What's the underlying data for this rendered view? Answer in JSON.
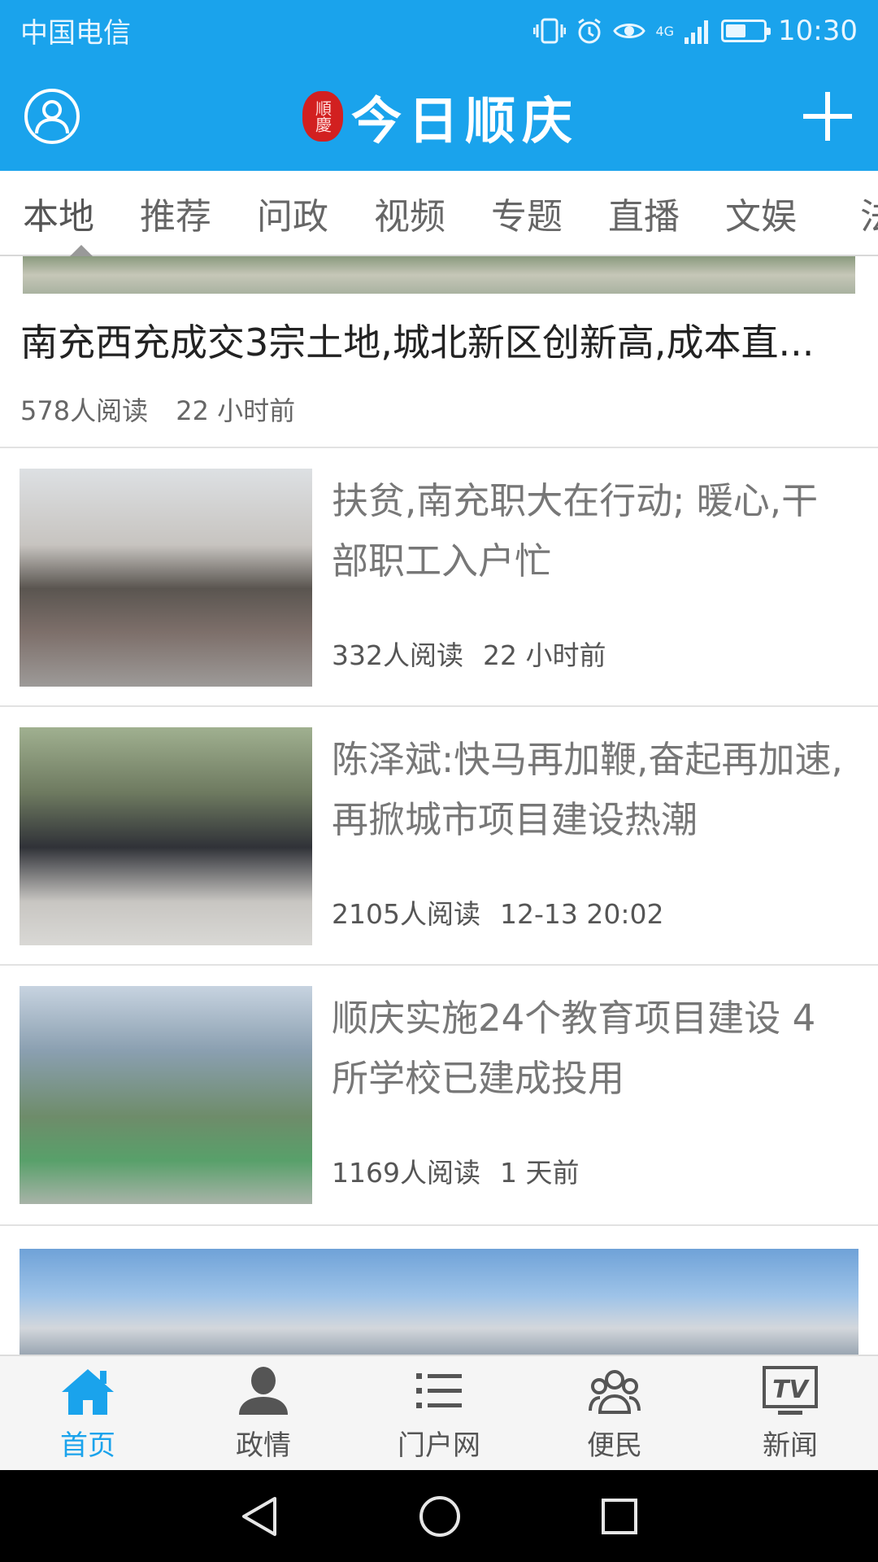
{
  "status_bar": {
    "carrier": "中国电信",
    "network": "4G",
    "time": "10:30",
    "battery_level": 0.55
  },
  "header": {
    "logo_seal": "順慶",
    "logo_text": "今日顺庆",
    "icons": [
      "avatar-icon",
      "plus-icon"
    ]
  },
  "tabs": [
    {
      "label": "本地",
      "active": true
    },
    {
      "label": "推荐"
    },
    {
      "label": "问政"
    },
    {
      "label": "视频"
    },
    {
      "label": "专题"
    },
    {
      "label": "直播"
    },
    {
      "label": "文娱"
    },
    {
      "label": "法"
    }
  ],
  "feed": {
    "featured": {
      "title": "南充西充成交3宗土地,城北新区创新高,成本直...",
      "reads": "578人阅读",
      "time": "22 小时前"
    },
    "items": [
      {
        "title": "扶贫,南充职大在行动; 暖心,干部职工入户忙",
        "reads": "332人阅读",
        "time": "22 小时前"
      },
      {
        "title": "陈泽斌:快马再加鞭,奋起再加速,再掀城市项目建设热潮",
        "reads": "2105人阅读",
        "time": "12-13 20:02"
      },
      {
        "title": "顺庆实施24个教育项目建设 4所学校已建成投用",
        "reads": "1169人阅读",
        "time": "1 天前"
      }
    ]
  },
  "bottom_nav": [
    {
      "label": "首页",
      "icon": "home-icon",
      "active": true
    },
    {
      "label": "政情",
      "icon": "person-icon"
    },
    {
      "label": "门户网",
      "icon": "list-icon"
    },
    {
      "label": "便民",
      "icon": "group-icon"
    },
    {
      "label": "新闻",
      "icon": "tv-icon",
      "icon_text": "TV"
    }
  ],
  "colors": {
    "brand_blue": "#1aa3ec",
    "seal_red": "#d22020"
  }
}
